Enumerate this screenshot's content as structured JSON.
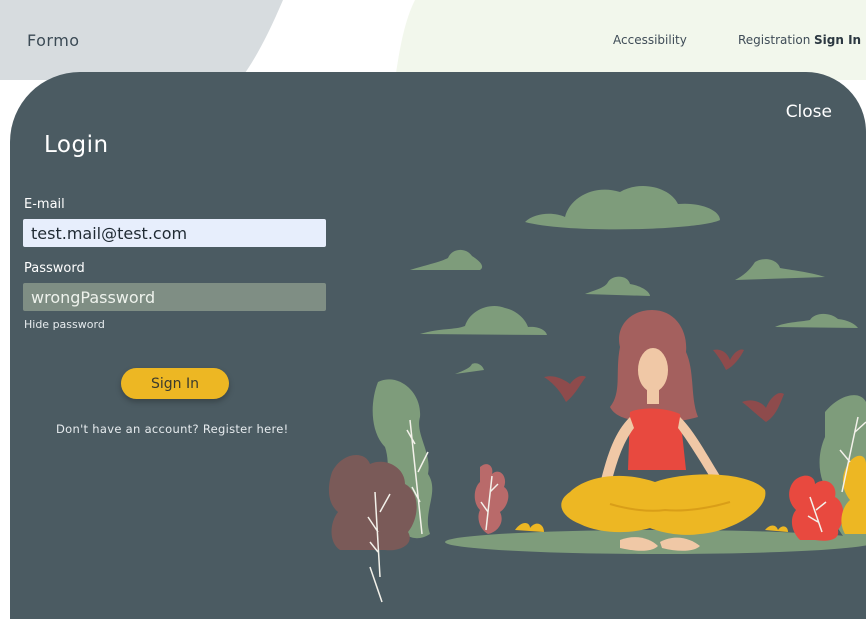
{
  "header": {
    "brand": "Formo",
    "nav": {
      "accessibility": "Accessibility",
      "registration": "Registration",
      "sign_in": "Sign In"
    }
  },
  "modal": {
    "close_label": "Close",
    "title": "Login",
    "email": {
      "label": "E-mail",
      "value": "test.mail@test.com"
    },
    "password": {
      "label": "Password",
      "value": "wrongPassword",
      "toggle_label": "Hide password"
    },
    "submit_label": "Sign In",
    "register_prompt": "Don't have an account? Register here!"
  },
  "colors": {
    "modal_bg": "#4b5b62",
    "accent": "#edb723",
    "email_field_bg": "#e7eefc",
    "password_field_bg": "#7f8e84"
  }
}
